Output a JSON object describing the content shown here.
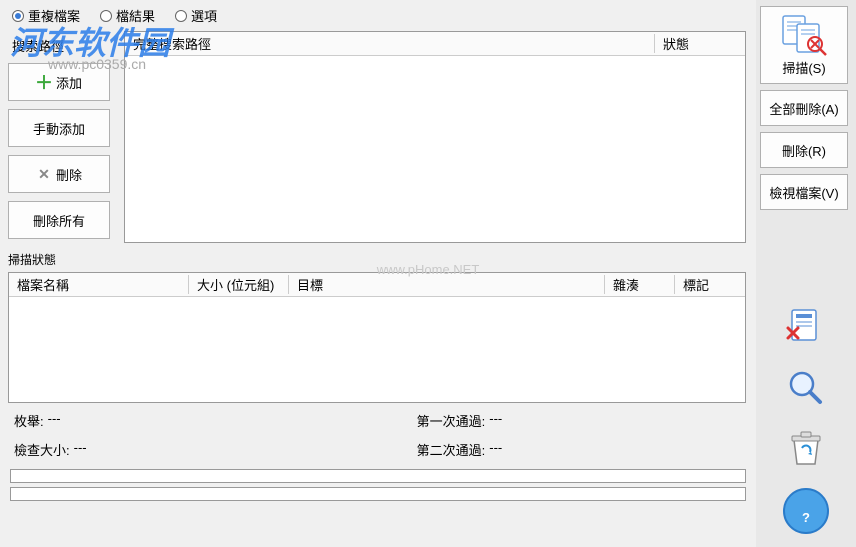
{
  "tabs": {
    "duplicate_files": "重複檔案",
    "results": "檔結果",
    "options": "選項"
  },
  "buttons": {
    "search_path": "搜索路徑",
    "add": "添加",
    "manual_add": "手動添加",
    "delete": "刪除",
    "delete_all": "刪除所有"
  },
  "path_table": {
    "col_path": "完整搜索路徑",
    "col_status": "狀態"
  },
  "scan_status_label": "掃描狀態",
  "result_table": {
    "col_name": "檔案名稱",
    "col_size": "大小 (位元組)",
    "col_target": "目標",
    "col_hash": "雜湊",
    "col_mark": "標記"
  },
  "stats": {
    "enum_label": "枚舉:",
    "enum_value": "---",
    "check_size_label": "檢查大小:",
    "check_size_value": "---",
    "first_pass_label": "第一次通過:",
    "first_pass_value": "---",
    "second_pass_label": "第二次通過:",
    "second_pass_value": "---"
  },
  "right": {
    "scan": "掃描(S)",
    "delete_all": "全部刪除(A)",
    "delete": "刪除(R)",
    "view_file": "檢視檔案(V)"
  },
  "watermark": {
    "main": "河东软件园",
    "sub": "www.pc0359.cn",
    "center": "www.pHome.NET"
  }
}
